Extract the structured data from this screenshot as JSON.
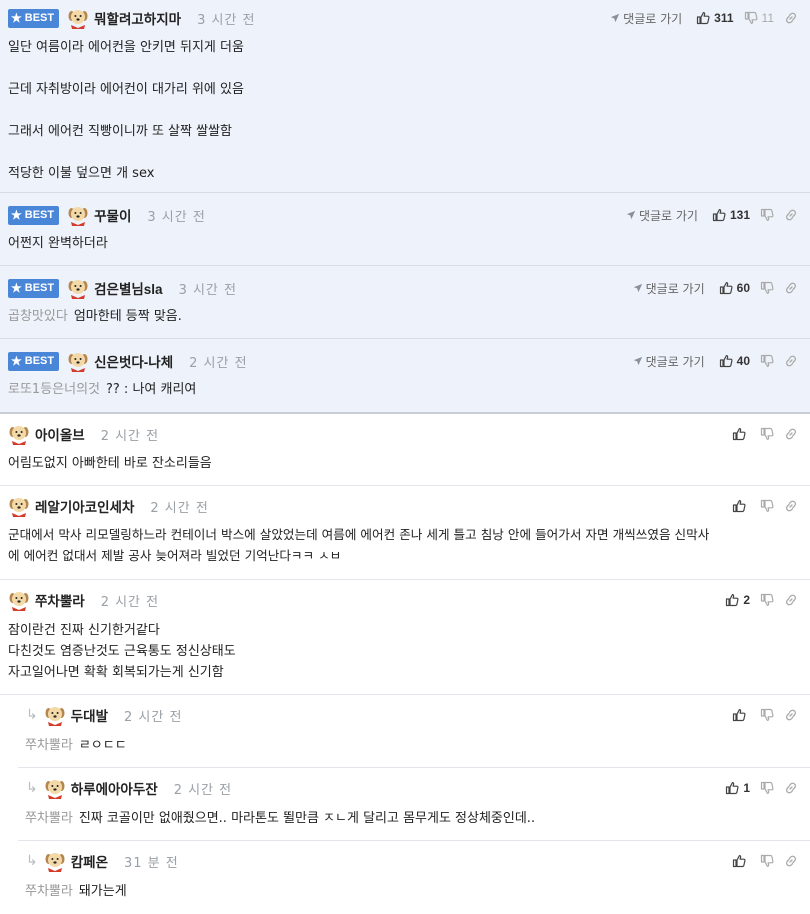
{
  "reply_label": "댓글로 가기",
  "best_label": "BEST",
  "comments": [
    {
      "nick": "뭐할려고하지마",
      "time": "3 시간 전",
      "up": "311",
      "down": "11",
      "lines": [
        "일단 여름이라 에어컨을 안키면 뒤지게 더움",
        "",
        "근데 자취방이라 에어컨이 대가리 위에 있음",
        "",
        "그래서 에어컨 직빵이니까 또 살짝 쌀쌀함",
        "",
        "적당한 이불 덮으면 개 sex"
      ]
    },
    {
      "nick": "꾸물이",
      "time": "3 시간 전",
      "up": "131",
      "lines": [
        "어쩐지 완벽하더라"
      ]
    },
    {
      "nick": "검은별님sla",
      "time": "3 시간 전",
      "up": "60",
      "quote": "곱창맛있다",
      "text": "엄마한테 등짝 맞음."
    },
    {
      "nick": "신은벗다-나체",
      "time": "2 시간 전",
      "up": "40",
      "quote": "로또1등은너의것",
      "text": "?? : 나여 캐리여"
    },
    {
      "nick": "아이올브",
      "time": "2 시간 전",
      "up": "",
      "lines": [
        "어림도없지 아빠한테 바로 잔소리들음"
      ]
    },
    {
      "nick": "레알기아코인세차",
      "time": "2 시간 전",
      "up": "",
      "lines": [
        "군대에서 막사 리모델링하느라 컨테이너 박스에 살았었는데 여름에 에어컨 존나 세게 틀고 침낭 안에 들어가서 자면 개씩쓰였음 신막사",
        "에 에어컨 없대서 제발 공사 늦어져라 빌었던 기억난다ㅋㅋ ㅅㅂ"
      ]
    },
    {
      "nick": "쭈차뿔라",
      "time": "2 시간 전",
      "up": "2",
      "lines": [
        "잠이란건 진짜 신기한거같다",
        "다친것도 염증난것도 근육통도 정신상태도",
        "자고일어나면 확확 회복되가는게 신기함"
      ]
    },
    {
      "nick": "두대발",
      "time": "2 시간 전",
      "up": "",
      "quote": "쭈차뿔라",
      "text": "ㄹㅇㄷㄷ"
    },
    {
      "nick": "하루에아아두잔",
      "time": "2 시간 전",
      "up": "1",
      "quote": "쭈차뿔라",
      "text": "진짜 코골이만 없애줬으면.. 마라톤도 뛸만큼 ㅈㄴ게 달리고 몸무게도 정상체중인데.."
    },
    {
      "nick": "캄페온",
      "time": "31 분 전",
      "up": "",
      "quote": "쭈차뿔라",
      "text": "돼가는게"
    }
  ],
  "icons": {
    "avatar": "dog-avatar-icon",
    "thumb_up": "thumbs-up-icon",
    "thumb_down": "thumbs-down-icon",
    "link": "link-icon",
    "reply": "reply-arrow-icon",
    "star": "star-icon",
    "sub_arrow": "sub-reply-arrow-icon"
  },
  "colors": {
    "best_bg": "#eef3fb",
    "badge": "#4a86d8",
    "meta": "#9aa0a6"
  }
}
